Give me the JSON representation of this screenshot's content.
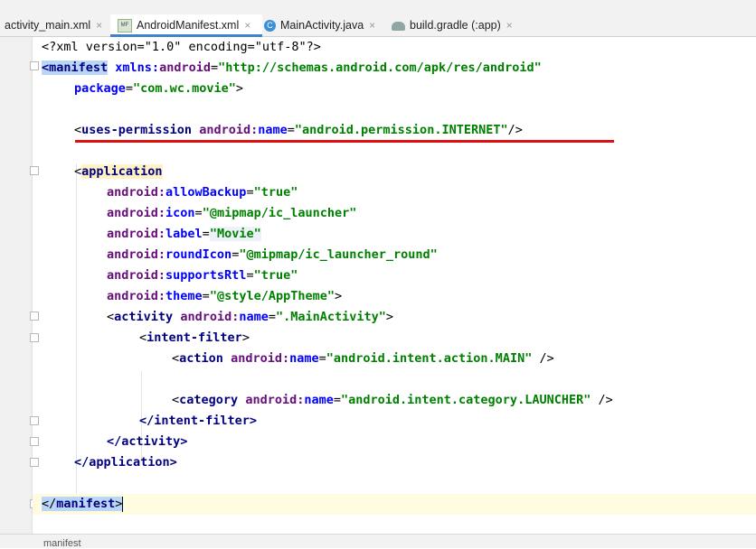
{
  "tabs": [
    {
      "label": "activity_main.xml",
      "icon": "xml-file-icon",
      "active": false
    },
    {
      "label": "AndroidManifest.xml",
      "icon": "manifest-file-icon",
      "active": true
    },
    {
      "label": "MainActivity.java",
      "icon": "java-class-icon",
      "active": false
    },
    {
      "label": "build.gradle (:app)",
      "icon": "gradle-icon",
      "active": false
    }
  ],
  "code": {
    "xml_decl": "<?xml version=\"1.0\" encoding=\"utf-8\"?>",
    "manifest_open": "<manifest",
    "xmlns_prefix": "xmlns:",
    "xmlns_name": "android",
    "xmlns_value": "\"http://schemas.android.com/apk/res/android\"",
    "package_attr": "package",
    "package_value": "\"com.wc.movie\"",
    "uses_permission_tag": "uses-permission",
    "name_attr": "name",
    "android_prefix": "android:",
    "permission_value": "\"android.permission.INTERNET\"",
    "application_tag": "application",
    "allowBackup_attr": "allowBackup",
    "allowBackup_value": "\"true\"",
    "icon_attr": "icon",
    "icon_value": "\"@mipmap/ic_launcher\"",
    "label_attr": "label",
    "label_value": "\"Movie\"",
    "roundIcon_attr": "roundIcon",
    "roundIcon_value": "\"@mipmap/ic_launcher_round\"",
    "supportsRtl_attr": "supportsRtl",
    "supportsRtl_value": "\"true\"",
    "theme_attr": "theme",
    "theme_value": "\"@style/AppTheme\"",
    "activity_tag": "activity",
    "activity_name_value": "\".MainActivity\"",
    "intent_filter_tag": "intent-filter",
    "action_tag": "action",
    "action_value": "\"android.intent.action.MAIN\"",
    "category_tag": "category",
    "category_value": "\"android.intent.category.LAUNCHER\"",
    "close_intent_filter": "</intent-filter>",
    "close_activity": "</activity>",
    "close_application": "</application>",
    "close_manifest": "manifest"
  },
  "statusbar": {
    "breadcrumb": "manifest"
  },
  "colors": {
    "annotation_underline": "#e01010",
    "active_tab_accent": "#4083c9"
  }
}
